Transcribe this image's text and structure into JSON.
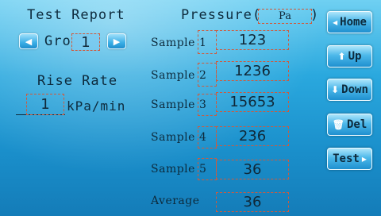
{
  "report": {
    "title": "Test Report",
    "group_label": "Gro",
    "group_value": "1",
    "prev_icon": "left-arrow-icon",
    "next_icon": "right-arrow-icon"
  },
  "rise_rate": {
    "title": "Rise Rate",
    "value": "1",
    "unit": "kPa/min"
  },
  "pressure": {
    "title": "Pressure(",
    "close": ")",
    "unit": "Pa"
  },
  "samples": [
    {
      "label": "Sample",
      "index": "1",
      "value": "123"
    },
    {
      "label": "Sample",
      "index": "2",
      "value": "1236"
    },
    {
      "label": "Sample",
      "index": "3",
      "value": "15653"
    },
    {
      "label": "Sample",
      "index": "4",
      "value": "236"
    },
    {
      "label": "Sample",
      "index": "5",
      "value": "36"
    }
  ],
  "average": {
    "label": "Average",
    "value": "36"
  },
  "side_buttons": {
    "home": {
      "icon": "◂",
      "label": "Home"
    },
    "up": {
      "icon": "⬆",
      "label": "Up"
    },
    "down": {
      "icon": "⬇",
      "label": "Down"
    },
    "del": {
      "icon": "🗑",
      "label": "Del"
    },
    "test": {
      "label": "Test",
      "icon": "▸"
    }
  },
  "colors": {
    "dash_border": "#d05a3c",
    "button_top": "#aee6fb",
    "button_bottom": "#1f90cf"
  }
}
